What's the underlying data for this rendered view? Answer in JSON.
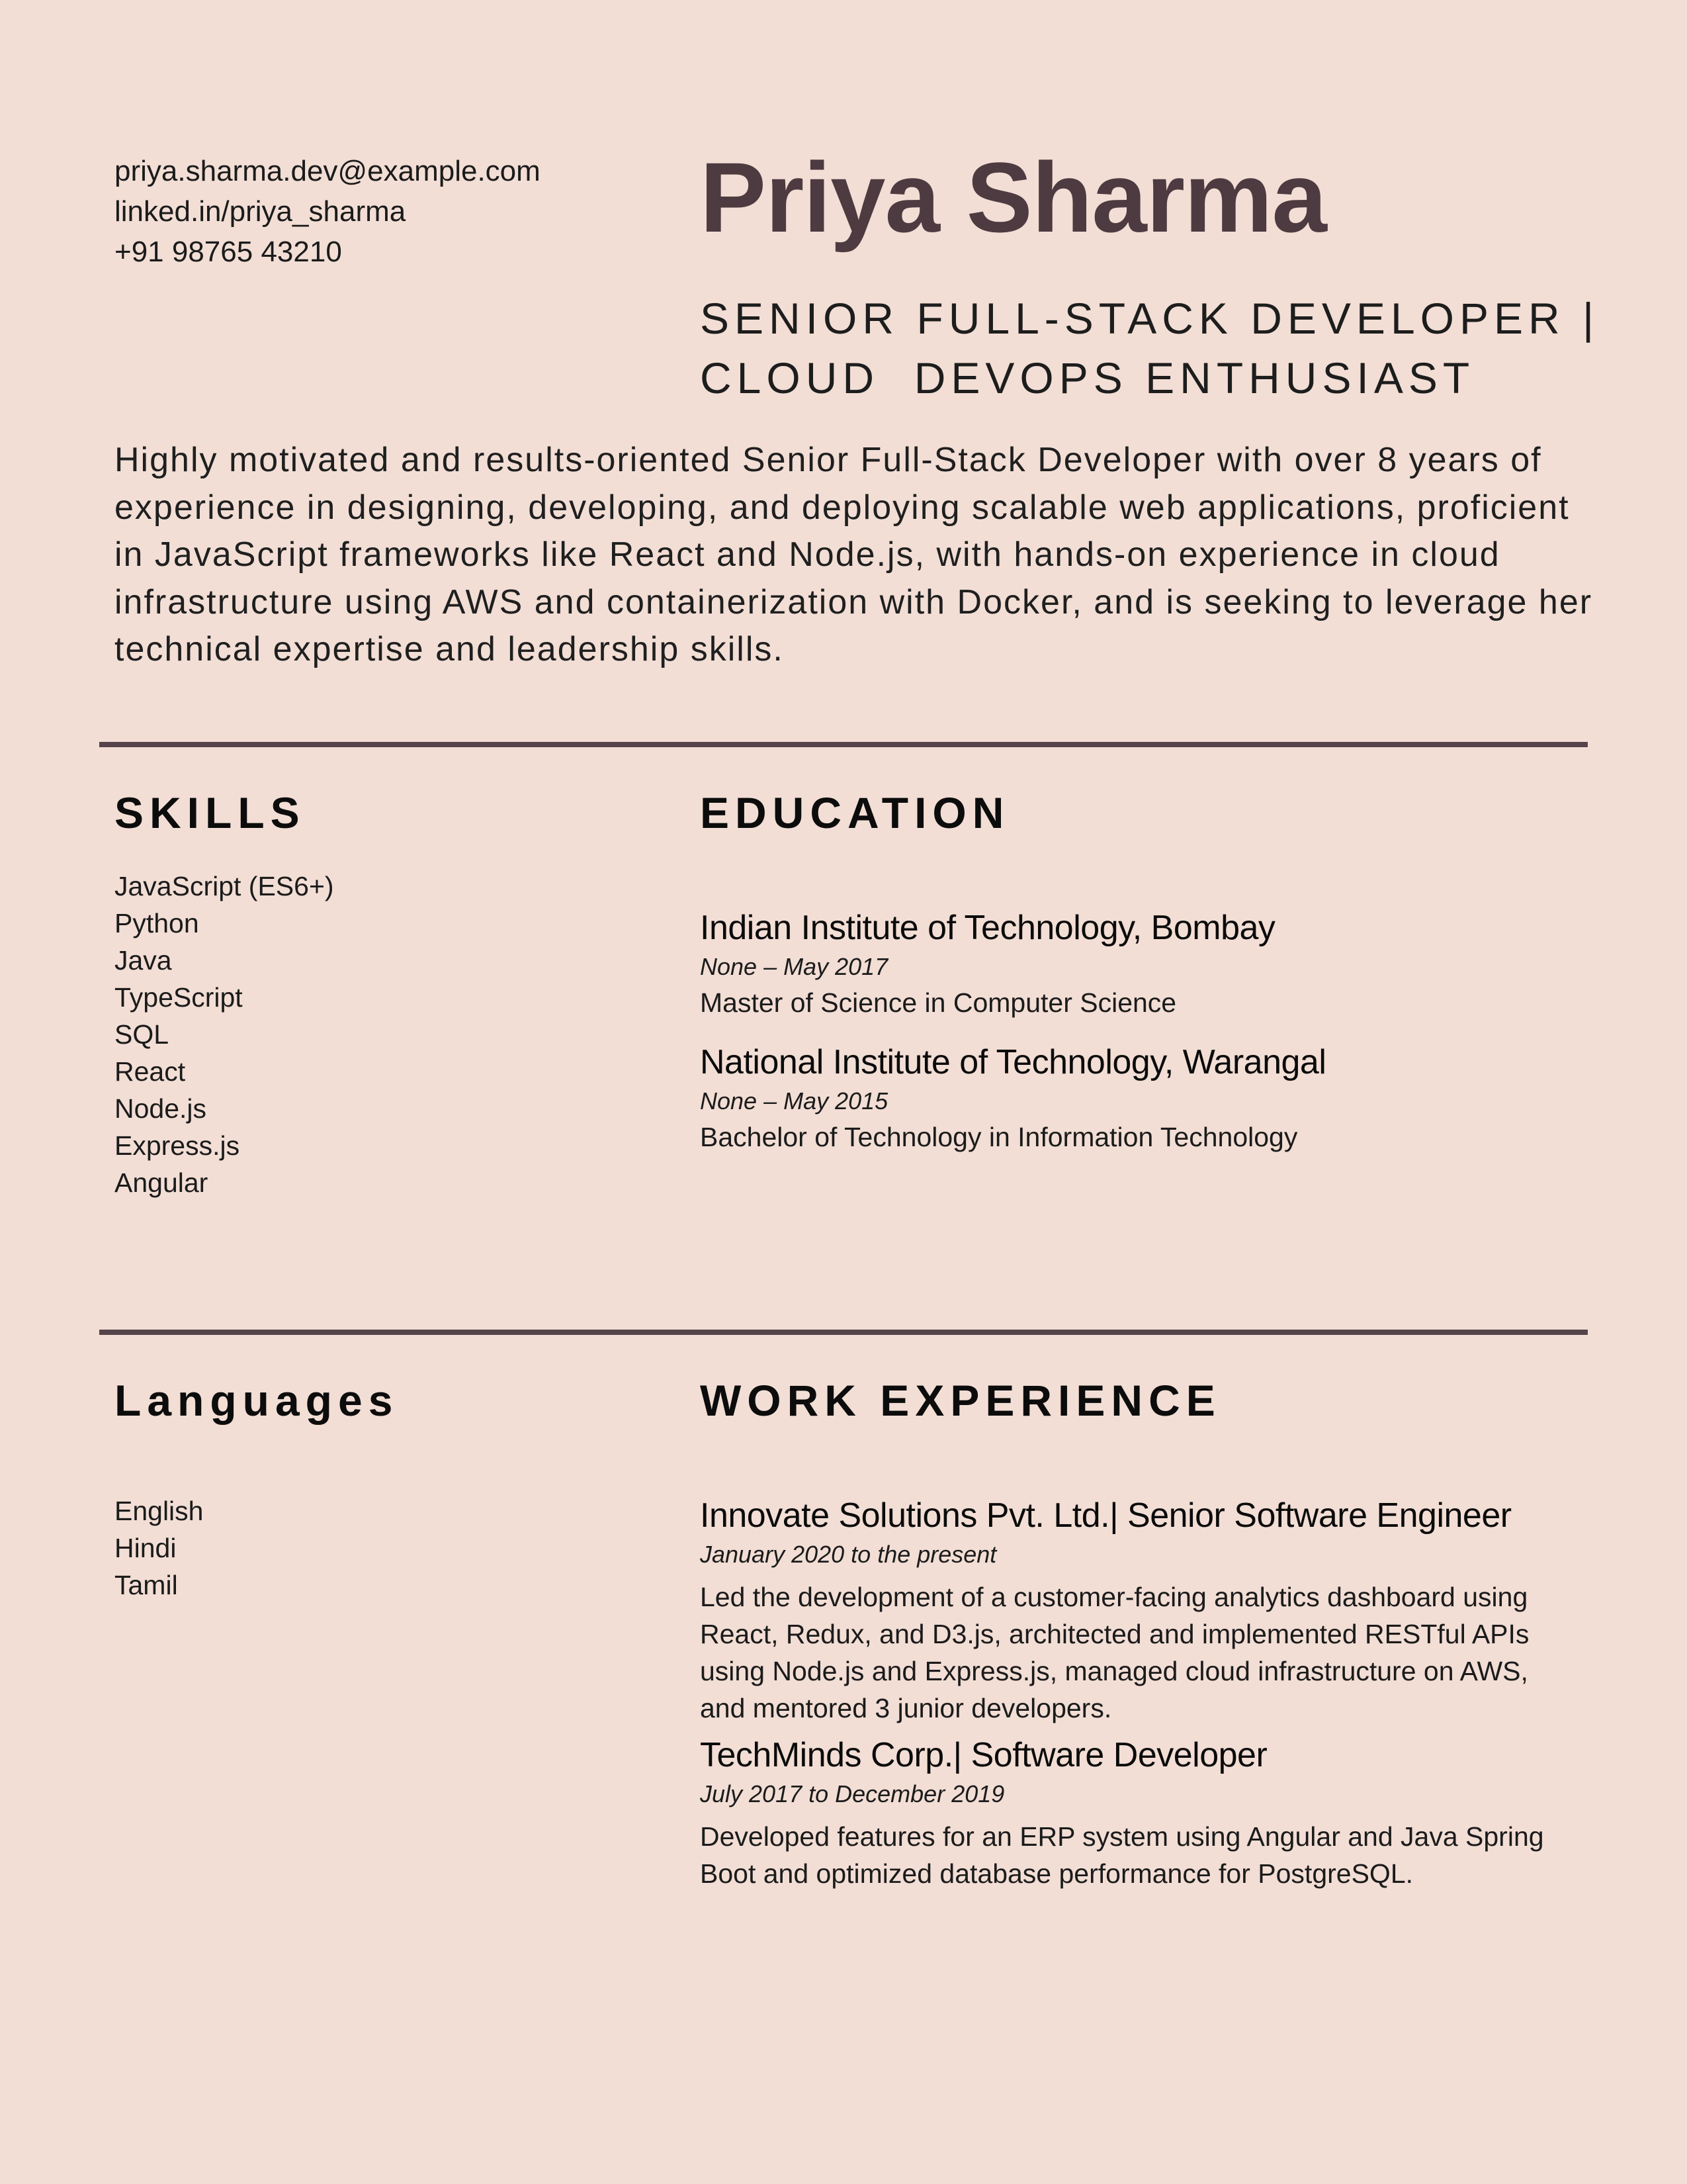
{
  "contact": {
    "email": "priya.sharma.dev@example.com",
    "linkedin": "linked.in/priya_sharma",
    "phone": "+91 98765 43210"
  },
  "header": {
    "name": "Priya Sharma",
    "title_line1": "SENIOR FULL-STACK DEVELOPER |",
    "title_line2": "CLOUD  DEVOPS ENTHUSIAST"
  },
  "summary": "Highly motivated and results-oriented Senior Full-Stack Developer with over 8 years of experience in designing, developing, and deploying scalable web applications, proficient in JavaScript frameworks like React and Node.js, with hands-on experience in cloud infrastructure using AWS and containerization with Docker, and is seeking to leverage her technical expertise and leadership skills.",
  "skills": {
    "heading": "SKILLS",
    "items": [
      "JavaScript (ES6+)",
      "Python",
      "Java",
      "TypeScript",
      "SQL",
      "React",
      "Node.js",
      "Express.js",
      "Angular"
    ]
  },
  "education": {
    "heading": "EDUCATION",
    "entries": [
      {
        "school": "Indian Institute of Technology, Bombay",
        "dates": "None – May 2017",
        "degree": "Master of Science in Computer Science"
      },
      {
        "school": "National Institute of Technology, Warangal",
        "dates": "None – May 2015",
        "degree": "Bachelor of Technology in Information Technology"
      }
    ]
  },
  "languages": {
    "heading": "Languages",
    "items": [
      "English",
      "Hindi",
      "Tamil"
    ]
  },
  "experience": {
    "heading": "WORK EXPERIENCE",
    "entries": [
      {
        "title": "Innovate Solutions Pvt. Ltd.| Senior Software Engineer",
        "dates": "January 2020 to the present",
        "description": "Led the development of a customer-facing analytics dashboard using React, Redux, and D3.js, architected and implemented RESTful APIs using Node.js and Express.js, managed cloud infrastructure on AWS, and mentored 3 junior developers."
      },
      {
        "title": "TechMinds Corp.| Software Developer",
        "dates": "July 2017 to December 2019",
        "description": "Developed features for an ERP system using Angular and Java Spring Boot and optimized database performance for PostgreSQL."
      }
    ]
  },
  "colors": {
    "background": "#f2ded5",
    "accent": "#4d3b41",
    "divider": "#55444a"
  }
}
